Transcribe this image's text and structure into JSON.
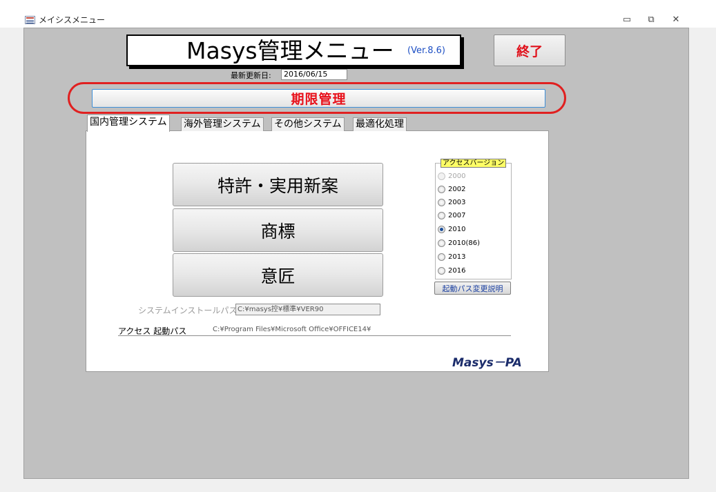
{
  "window": {
    "title": "メイシスメニュー",
    "min_glyph": "▭",
    "restore_glyph": "⧉",
    "close_glyph": "✕"
  },
  "header": {
    "title": "Masys管理メニュー",
    "version": "(Ver.8.6)",
    "exit_label": "終了",
    "last_updated_label": "最新更新日:",
    "last_updated_value": "2016/06/15"
  },
  "deadline_button_label": "期限管理",
  "tabs": [
    {
      "label": "国内管理システム",
      "active": true
    },
    {
      "label": "海外管理システム",
      "active": false
    },
    {
      "label": "その他システム",
      "active": false
    },
    {
      "label": "最適化処理",
      "active": false
    }
  ],
  "main": {
    "buttons": [
      "特許・実用新案",
      "商標",
      "意匠"
    ],
    "access_version": {
      "label": "アクセスバージョン",
      "options": [
        "2000",
        "2002",
        "2003",
        "2007",
        "2010",
        "2010(86)",
        "2013",
        "2016"
      ],
      "selected": "2010",
      "disabled": [
        "2000"
      ]
    },
    "path_help_label": "起動パス変更説明",
    "install_path_label": "システムインストールパス",
    "install_path_value": "C:¥masys控¥標準¥VER90",
    "access_path_label": "アクセス 起動パス",
    "access_path_value": "C:¥Program Files¥Microsoft Office¥OFFICE14¥",
    "brand": "Masys－PA"
  },
  "colors": {
    "accent_red": "#e8101a",
    "highlight_oval": "#e02020",
    "brand_navy": "#1b2c6b",
    "version_blue": "#1d4fc4"
  }
}
